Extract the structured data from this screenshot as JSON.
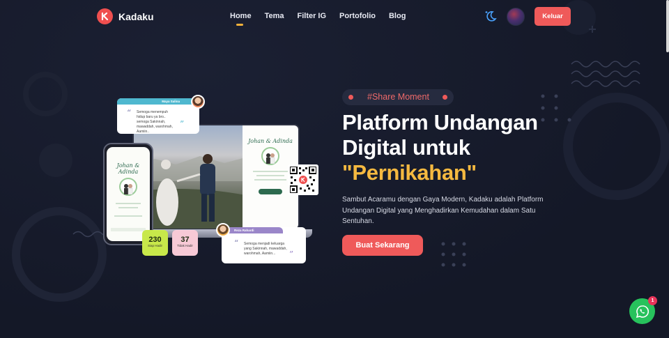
{
  "brand": {
    "name": "Kadaku",
    "logo_icon": "kadaku-k-logo-icon",
    "accent": "#ef5a5a"
  },
  "nav": {
    "items": [
      {
        "label": "Home",
        "active": true
      },
      {
        "label": "Tema",
        "active": false
      },
      {
        "label": "Filter IG",
        "active": false
      },
      {
        "label": "Portofolio",
        "active": false
      },
      {
        "label": "Blog",
        "active": false
      }
    ]
  },
  "header": {
    "theme_toggle_icon": "moon-icon",
    "logout_label": "Keluar"
  },
  "hero": {
    "tag": "#Share Moment",
    "title_line1": "Platform Undangan",
    "title_line2": "Digital untuk",
    "title_highlight": "\"Pernikahan\"",
    "description": "Sambut Acaramu dengan Gaya Modern, Kadaku adalah Platform Undangan Digital yang Menghadirkan Kemudahan dalam Satu Sentuhan.",
    "cta_label": "Buat Sekarang",
    "highlight_color": "#f5b940"
  },
  "mockup": {
    "invite_names": "Johan & Adinda",
    "comment_top": {
      "name": "Maya Salina",
      "text": "Semoga menempuh hidup baru ya bro.. semoga Sakinnah, mawaddah, warohmah, Aamiin.."
    },
    "comment_bottom": {
      "name": "Reza Rahardi",
      "text": "Semoga menjadi keluarga yang Sakinnah, mawaddah, warohmah, Aamiin..."
    },
    "stat_present": {
      "value": "230",
      "label": "Siap Hadir"
    },
    "stat_absent": {
      "value": "37",
      "label": "Tidak Hadir"
    }
  },
  "floating": {
    "whatsapp_icon": "whatsapp-icon",
    "badge_count": "1"
  }
}
